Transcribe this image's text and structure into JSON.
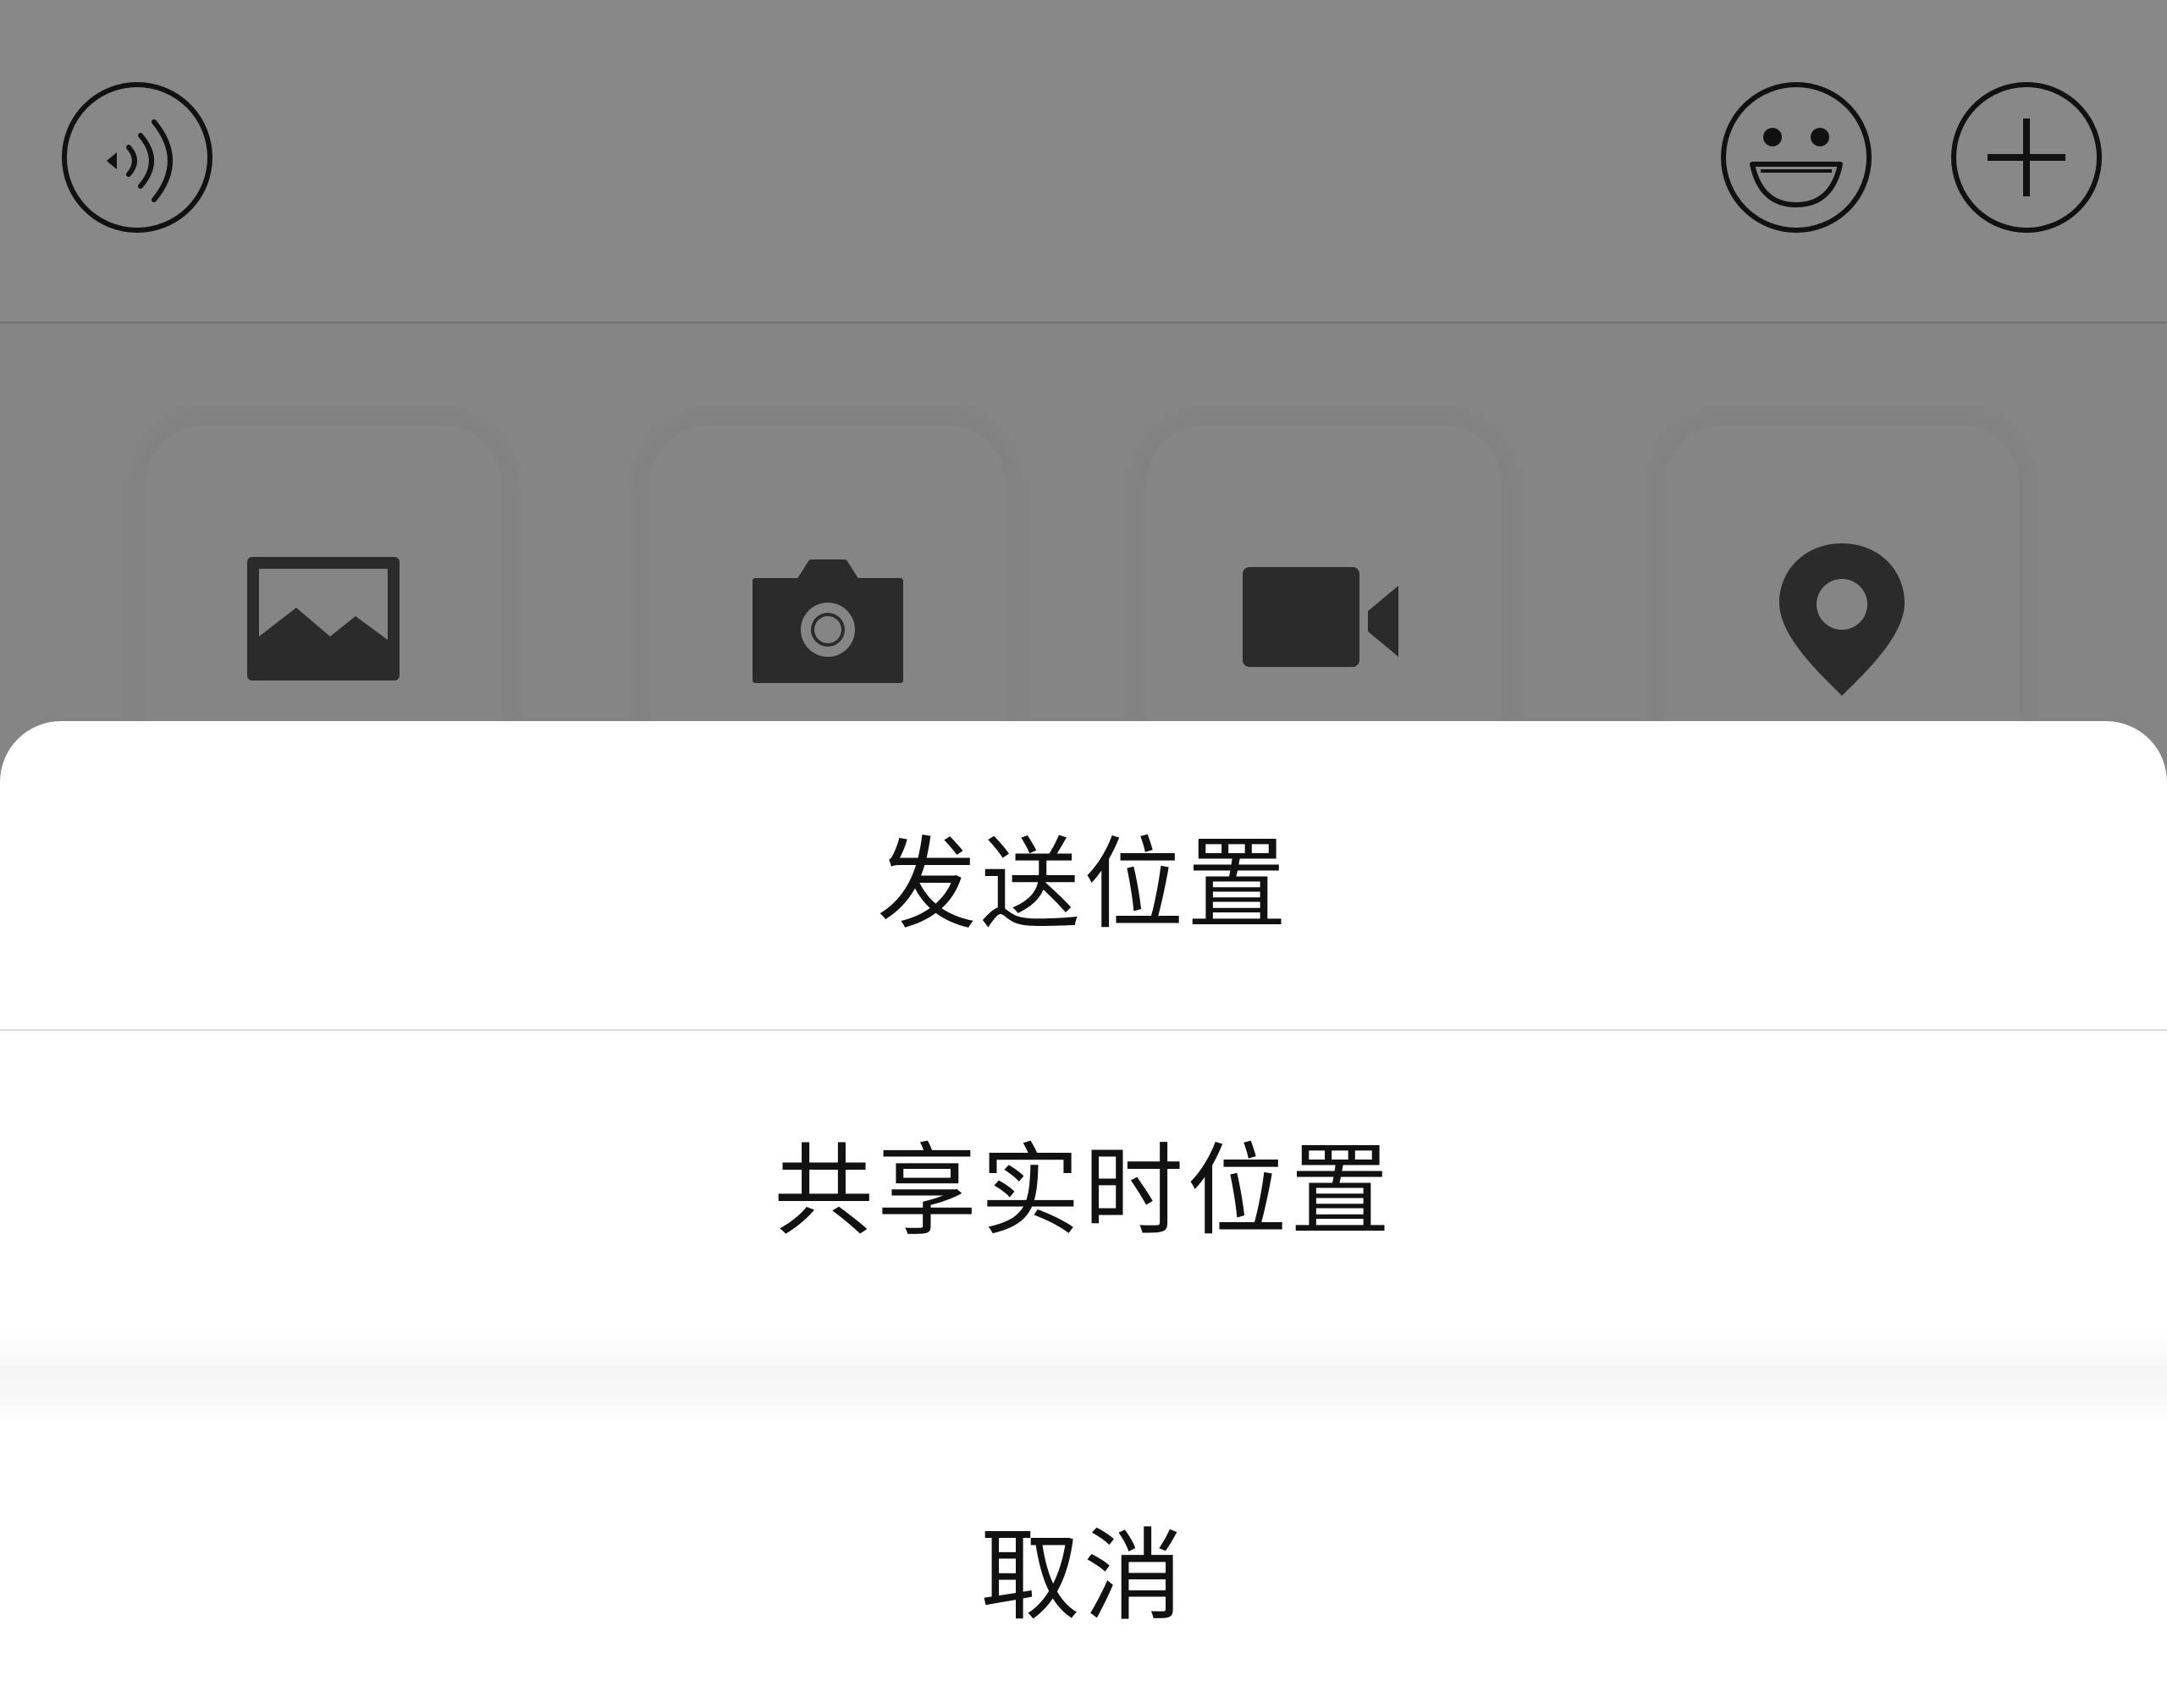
{
  "input_bar": {
    "voice_icon": "voice-icon",
    "emoji_icon": "emoji-icon",
    "plus_icon": "plus-icon"
  },
  "tools": [
    {
      "id": "album",
      "icon": "image-icon"
    },
    {
      "id": "camera",
      "icon": "camera-icon"
    },
    {
      "id": "video",
      "icon": "video-camera-icon"
    },
    {
      "id": "location",
      "icon": "location-pin-icon"
    }
  ],
  "action_sheet": {
    "send_location": "发送位置",
    "share_live_location": "共享实时位置",
    "cancel": "取消"
  },
  "colors": {
    "dimmed_background": "#858585",
    "sheet_background": "#ffffff",
    "text": "#111111",
    "icon": "#2b2b2b"
  }
}
